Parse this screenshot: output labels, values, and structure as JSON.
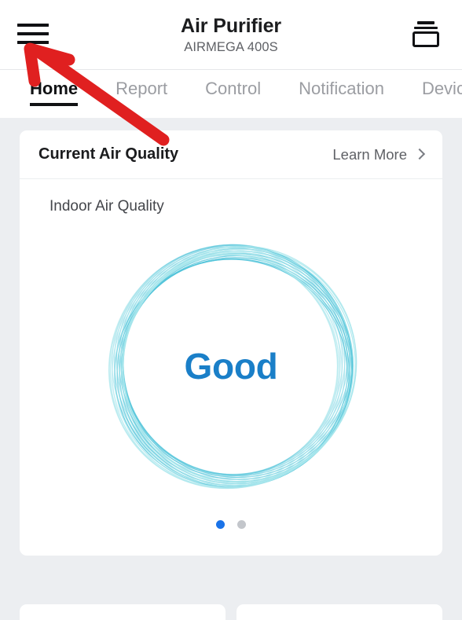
{
  "header": {
    "menu_icon": "hamburger-menu-icon",
    "title": "Air Purifier",
    "subtitle": "AIRMEGA 400S",
    "devices_icon": "stacked-devices-icon"
  },
  "tabs": [
    {
      "label": "Home",
      "active": true
    },
    {
      "label": "Report",
      "active": false
    },
    {
      "label": "Control",
      "active": false
    },
    {
      "label": "Notification",
      "active": false
    },
    {
      "label": "Device Ma",
      "active": false
    }
  ],
  "air_quality_card": {
    "title": "Current Air Quality",
    "learn_more_label": "Learn More",
    "learn_more_icon": "chevron-right-icon",
    "section_label": "Indoor Air Quality",
    "gauge": {
      "value_label": "Good",
      "value_color": "#1a7fc8",
      "ring_color_outer": "#4fc3d9",
      "ring_color_inner": "#a8e6ec"
    },
    "pagination": {
      "total": 2,
      "active_index": 0
    }
  },
  "annotation": {
    "type": "arrow",
    "color": "#e02020",
    "points_to": "hamburger-menu-icon"
  }
}
